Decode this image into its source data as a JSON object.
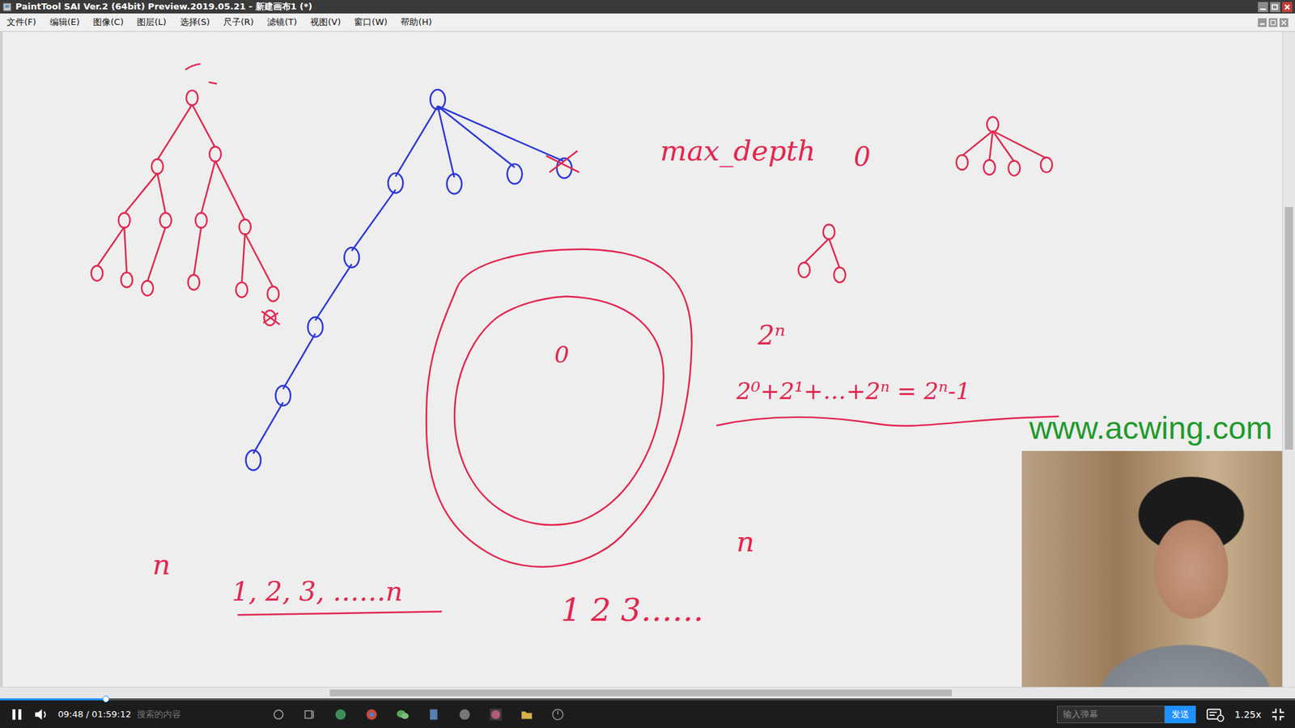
{
  "window": {
    "title": "PaintTool SAI Ver.2 (64bit) Preview.2019.05.21 - 新建画布1 (*)"
  },
  "menu": [
    "文件(F)",
    "编辑(E)",
    "图像(C)",
    "图层(L)",
    "选择(S)",
    "尺子(R)",
    "滤镜(T)",
    "视图(V)",
    "窗口(W)",
    "帮助(H)"
  ],
  "canvas": {
    "annotations": [
      {
        "text": "max_depth"
      },
      {
        "text": "0"
      },
      {
        "text": "2ⁿ"
      },
      {
        "text": "2⁰+2¹+…+2ⁿ = 2ⁿ-1"
      },
      {
        "text": "n"
      },
      {
        "text": "1, 2, 3, ……n"
      },
      {
        "text": "1    2    3……"
      },
      {
        "text": "n"
      },
      {
        "text": "0"
      }
    ]
  },
  "watermark": "www.acwing.com",
  "player": {
    "playing": true,
    "progress": 0.082,
    "time": "09:48 / 01:59:12",
    "search_hint": "搜索的内容",
    "danmaku_placeholder": "输入弹幕",
    "send": "发送",
    "speed": "1.25x"
  }
}
